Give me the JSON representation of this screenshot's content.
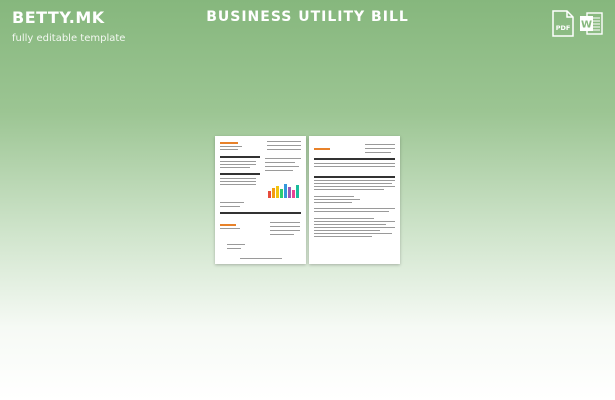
{
  "brand": {
    "logo": "BETTY.MK",
    "tagline": "fully editable template"
  },
  "header": {
    "title": "BUSINESS UTILITY BILL"
  },
  "formats": [
    {
      "name": "pdf",
      "label": "PDF",
      "color": "#ffffff"
    },
    {
      "name": "word",
      "label": "W",
      "color": "#ffffff"
    }
  ],
  "colors": {
    "accent": "#e8822a",
    "background_top": "#86b77d",
    "background_bottom": "#ffffff"
  },
  "preview": {
    "pages": 2
  }
}
